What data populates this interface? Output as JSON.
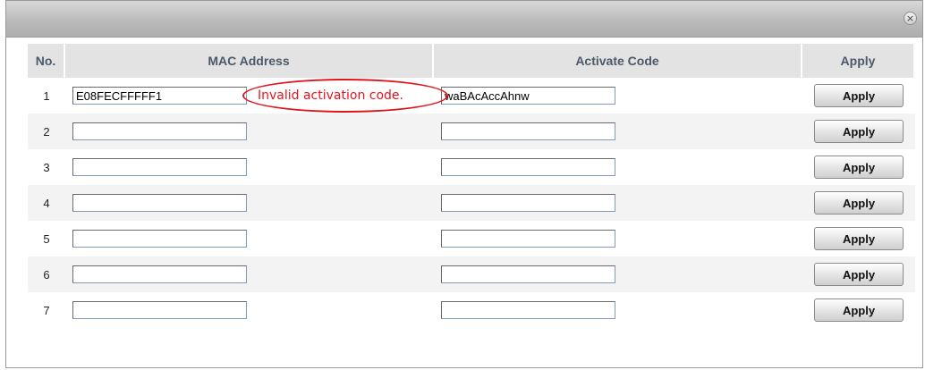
{
  "dialog": {
    "close_icon": "×"
  },
  "table": {
    "headers": {
      "no": "No.",
      "mac": "MAC Address",
      "code": "Activate Code",
      "apply": "Apply"
    },
    "rows": [
      {
        "no": "1",
        "mac": "E08FECFFFFF1",
        "code": "waBAcAccAhnw",
        "button": "Apply",
        "error": "Invalid activation code."
      },
      {
        "no": "2",
        "mac": "",
        "code": "",
        "button": "Apply"
      },
      {
        "no": "3",
        "mac": "",
        "code": "",
        "button": "Apply"
      },
      {
        "no": "4",
        "mac": "",
        "code": "",
        "button": "Apply"
      },
      {
        "no": "5",
        "mac": "",
        "code": "",
        "button": "Apply"
      },
      {
        "no": "6",
        "mac": "",
        "code": "",
        "button": "Apply"
      },
      {
        "no": "7",
        "mac": "",
        "code": "",
        "button": "Apply"
      }
    ]
  },
  "colors": {
    "error": "#e8141f",
    "header_bg": "#e3e3e3",
    "title_bar": "#bdbdbd"
  }
}
